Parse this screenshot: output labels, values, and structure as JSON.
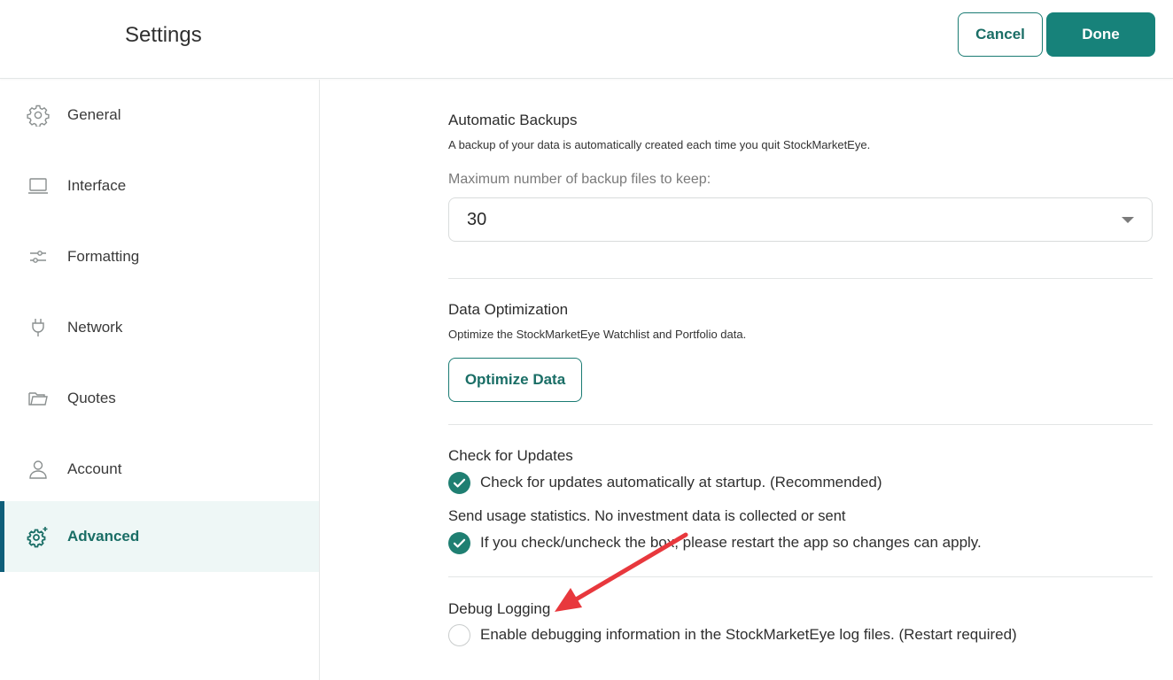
{
  "header": {
    "title": "Settings",
    "cancel_label": "Cancel",
    "done_label": "Done"
  },
  "sidebar": {
    "items": [
      {
        "label": "General",
        "icon": "gear-icon"
      },
      {
        "label": "Interface",
        "icon": "laptop-icon"
      },
      {
        "label": "Formatting",
        "icon": "sliders-icon"
      },
      {
        "label": "Network",
        "icon": "plug-icon"
      },
      {
        "label": "Quotes",
        "icon": "folder-icon"
      },
      {
        "label": "Account",
        "icon": "user-icon"
      },
      {
        "label": "Advanced",
        "icon": "advanced-gear-icon",
        "active": true
      }
    ]
  },
  "main": {
    "backups": {
      "title": "Automatic Backups",
      "description": "A backup of your data is automatically created each time you quit StockMarketEye.",
      "max_label": "Maximum number of backup files to keep:",
      "max_value": "30"
    },
    "optimization": {
      "title": "Data Optimization",
      "description": "Optimize the StockMarketEye Watchlist and Portfolio data.",
      "button_label": "Optimize Data"
    },
    "updates": {
      "title": "Check for Updates",
      "auto_check_label": "Check for updates automatically at startup. (Recommended)",
      "auto_check_checked": true,
      "usage_title": "Send usage statistics. No investment data is collected or sent",
      "usage_label": "If you check/uncheck the box, please restart the app so changes can apply.",
      "usage_checked": true
    },
    "debug": {
      "title": "Debug Logging",
      "label": "Enable debugging information in the StockMarketEye log files. (Restart required)",
      "checked": false
    }
  },
  "colors": {
    "accent": "#17827a",
    "active_bg": "#eef7f6",
    "active_bar": "#0f5f7a",
    "annotation_arrow": "#e8383d"
  }
}
